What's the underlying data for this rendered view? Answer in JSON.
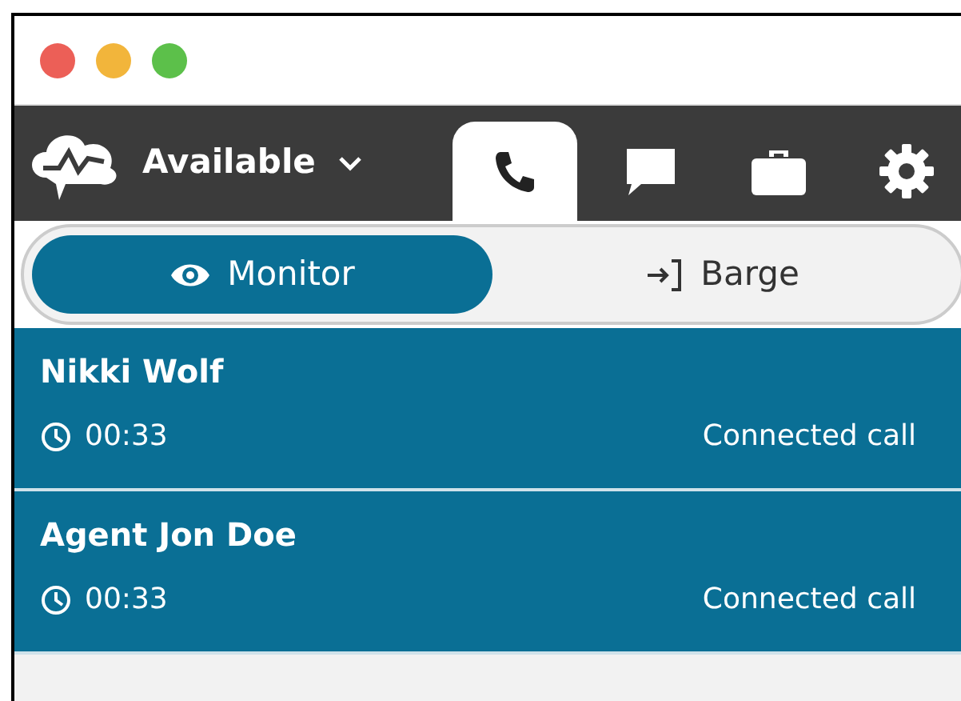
{
  "status": {
    "label": "Available"
  },
  "tabs": [
    {
      "kind": "phone",
      "selected": true
    },
    {
      "kind": "chat",
      "selected": false
    },
    {
      "kind": "briefcase",
      "selected": false
    },
    {
      "kind": "gear",
      "selected": false
    }
  ],
  "modes": [
    {
      "kind": "monitor",
      "label": "Monitor",
      "selected": true
    },
    {
      "kind": "barge",
      "label": "Barge",
      "selected": false
    }
  ],
  "contacts": [
    {
      "name": "Nikki Wolf",
      "duration": "00:33",
      "state": "Connected call"
    },
    {
      "name": "Agent Jon Doe",
      "duration": "00:33",
      "state": "Connected call"
    }
  ]
}
